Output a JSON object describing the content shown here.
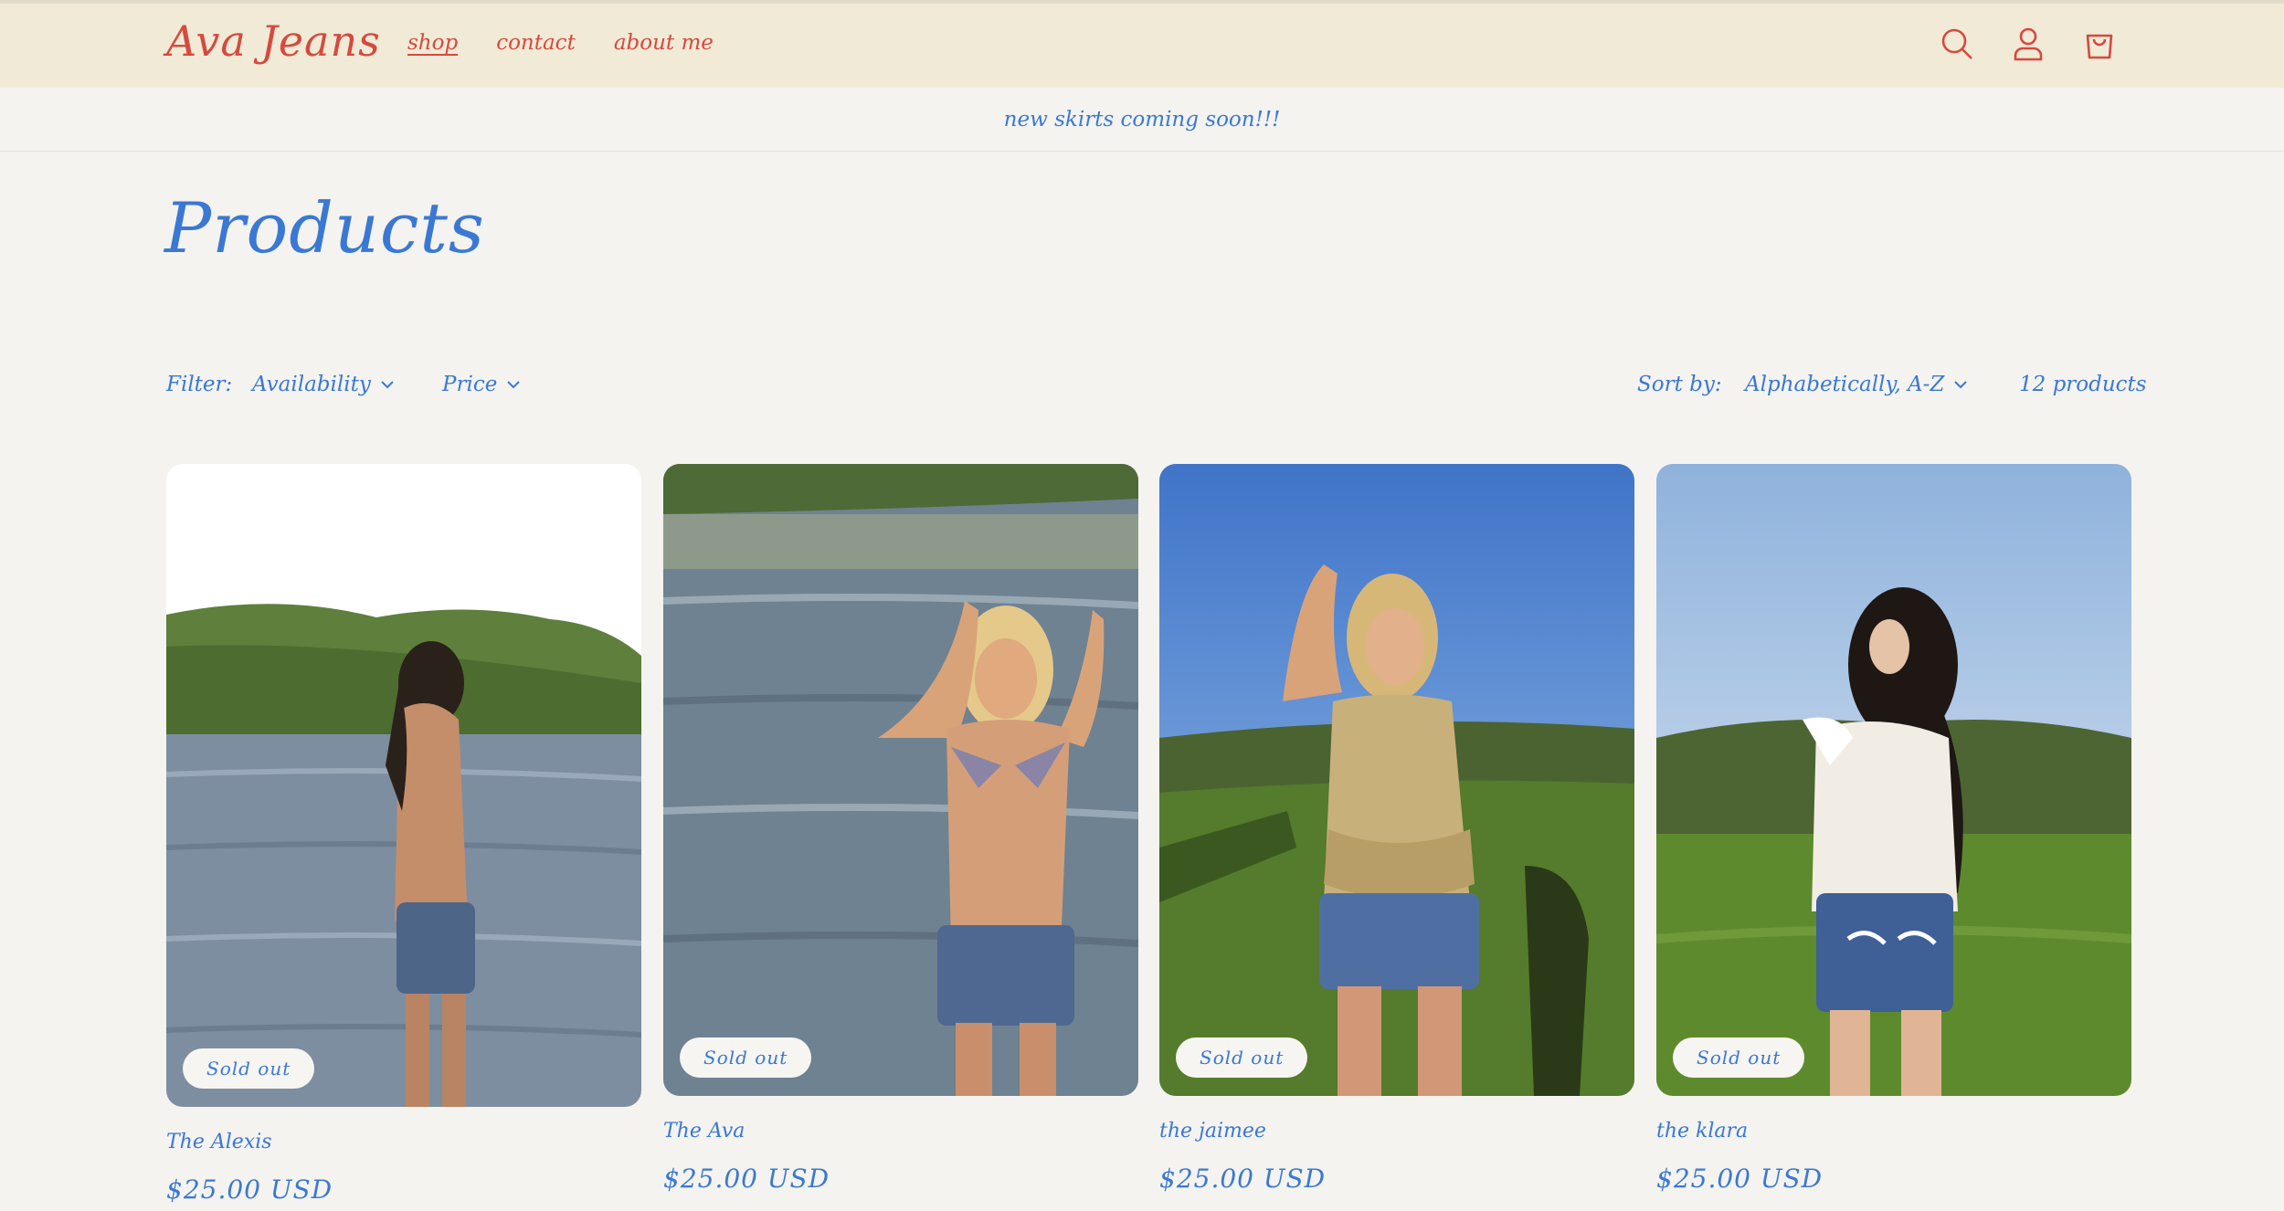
{
  "header": {
    "logo": "Ava Jeans",
    "nav": [
      "shop",
      "contact",
      "about me"
    ],
    "icons": [
      "search-icon",
      "account-icon",
      "cart-icon"
    ],
    "accent_color": "#d6493f",
    "background": "#f1ead6"
  },
  "announcement": "new skirts coming soon!!!",
  "page_title": "Products",
  "filters": {
    "label": "Filter:",
    "availability": "Availability",
    "price": "Price"
  },
  "sort": {
    "label": "Sort by:",
    "value": "Alphabetically, A-Z",
    "count": "12 products"
  },
  "theme_color": "#3a78d4",
  "products": [
    {
      "name": "The Alexis",
      "price": "$25.00 USD",
      "badge": "Sold out"
    },
    {
      "name": "The Ava",
      "price": "$25.00 USD",
      "badge": "Sold out"
    },
    {
      "name": "the jaimee",
      "price": "$25.00 USD",
      "badge": "Sold out"
    },
    {
      "name": "the klara",
      "price": "$25.00 USD",
      "badge": "Sold out"
    }
  ]
}
